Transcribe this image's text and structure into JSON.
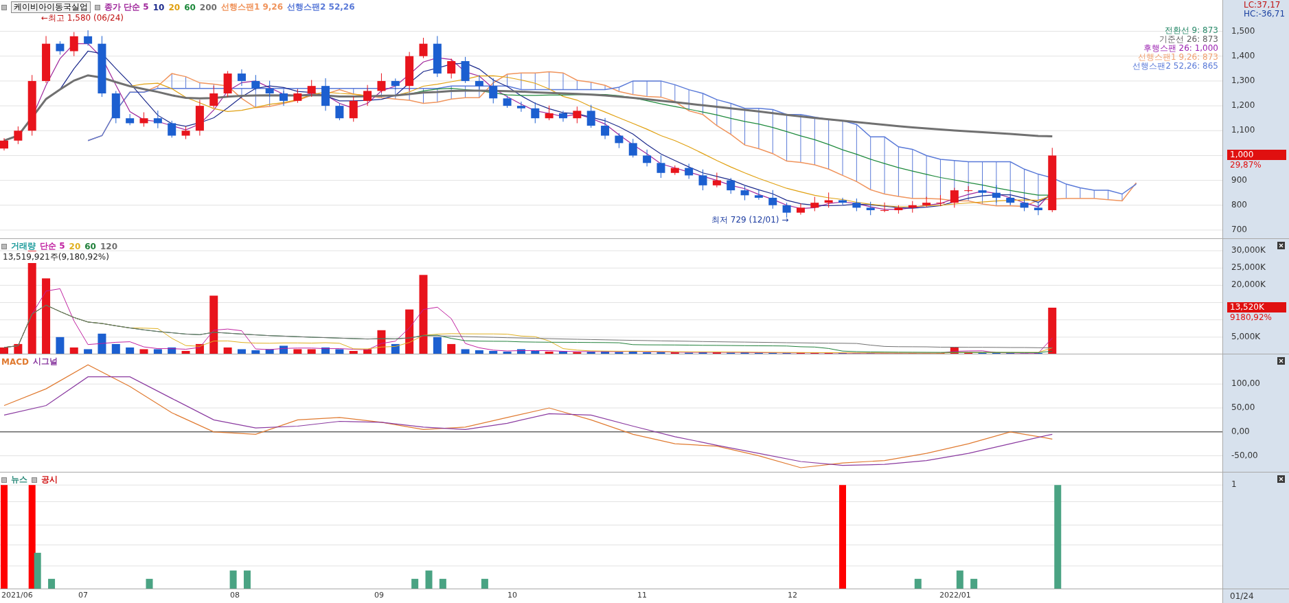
{
  "header": {
    "stock_button": "케이비아이동국실업",
    "legend": [
      {
        "text": "종가 단순 5",
        "color": "#a0289c"
      },
      {
        "text": "10",
        "color": "#1c2a8c"
      },
      {
        "text": "20",
        "color": "#e0a010"
      },
      {
        "text": "60",
        "color": "#1e8a3c"
      },
      {
        "text": "200",
        "color": "#707070"
      },
      {
        "text": "선행스팬1 9,26",
        "color": "#f0945c"
      },
      {
        "text": "선행스팬2 52,26",
        "color": "#5a7ad8"
      }
    ]
  },
  "price": {
    "high_marker": "←최고 1,580 (06/24)",
    "low_marker": "최저 729 (12/01) →",
    "lc": "LC:37,17",
    "hc": "HC:-36,71",
    "last_price": "1,000",
    "last_change": "29,87%",
    "ichimoku": [
      {
        "text": "전환선 9: 873",
        "color": "#2a8a6a"
      },
      {
        "text": "기준선 26: 873",
        "color": "#606060"
      },
      {
        "text": "후행스팬 26: 1,000",
        "color": "#9a20b0"
      },
      {
        "text": "선행스팬1 9,26: 873",
        "color": "#f0a070"
      },
      {
        "text": "선행스팬2 52,26: 865",
        "color": "#5a7ad8"
      }
    ],
    "axis_labels": [
      "1,500",
      "1,400",
      "1,300",
      "1,200",
      "1,100",
      "900",
      "800",
      "700"
    ]
  },
  "volume": {
    "legend": [
      {
        "text": "거래량",
        "color": "#1a9a9a"
      },
      {
        "text": "단순 5",
        "color": "#c020a0"
      },
      {
        "text": "20",
        "color": "#e0b020"
      },
      {
        "text": "60",
        "color": "#20803a"
      },
      {
        "text": "120",
        "color": "#707070"
      }
    ],
    "info": "13,519,921주(9,180,92%)",
    "last_volume": "13,520K",
    "last_ratio": "9180,92%",
    "axis_labels": [
      "30,000K",
      "25,000K",
      "20,000K",
      "5,000K"
    ]
  },
  "macd": {
    "legend": [
      {
        "text": "MACD",
        "color": "#e07a30"
      },
      {
        "text": "시그널",
        "color": "#8a3aa0"
      }
    ],
    "axis_labels": [
      "100,00",
      "50,00",
      "0,00",
      "-50,00"
    ]
  },
  "news": {
    "legend": [
      {
        "text": "뉴스",
        "color": "#2a8a7a"
      },
      {
        "text": "공시",
        "color": "#d01010"
      }
    ],
    "axis_labels": [
      "1"
    ]
  },
  "dates": [
    "2021/06",
    "07",
    "08",
    "09",
    "10",
    "11",
    "12",
    "2022/01"
  ],
  "last_date": "01/24"
}
